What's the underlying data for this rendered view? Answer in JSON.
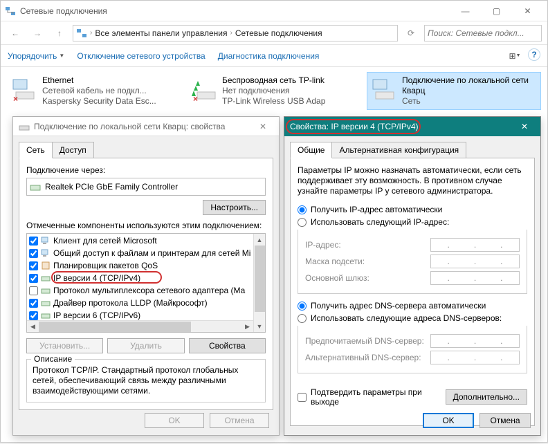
{
  "window": {
    "title": "Сетевые подключения",
    "breadcrumb": {
      "level1": "Все элементы панели управления",
      "level2": "Сетевые подключения"
    },
    "search_placeholder": "Поиск: Сетевые подкл...",
    "btn_min": "—",
    "btn_max": "▢",
    "btn_close": "✕",
    "nav_back": "←",
    "nav_fwd": "→",
    "nav_up": "↑",
    "nav_refresh": "⟳",
    "chevron": "›"
  },
  "toolbar": {
    "organize": "Упорядочить",
    "disable": "Отключение сетевого устройства",
    "diagnose": "Диагностика подключения",
    "view_icon": "⊞",
    "help_icon": "?"
  },
  "connections": [
    {
      "name": "Ethernet",
      "status": "Сетевой кабель не подкл...",
      "adapter": "Kaspersky Security Data Esc...",
      "state": "х"
    },
    {
      "name": "Беспроводная сеть TP-link",
      "status": "Нет подключения",
      "adapter": "TP-Link Wireless USB Adap",
      "state": "х"
    },
    {
      "name": "Подключение по локальной сети Кварц",
      "status": "Сеть",
      "adapter": "",
      "state": "ok"
    }
  ],
  "props": {
    "title": "Подключение по локальной сети Кварц: свойства",
    "tabs": {
      "net": "Сеть",
      "access": "Доступ"
    },
    "connect_via": "Подключение через:",
    "adapter": "Realtek PCIe GbE Family Controller",
    "configure": "Настроить...",
    "checked_label": "Отмеченные компоненты используются этим подключением:",
    "components": [
      {
        "checked": true,
        "label": "Клиент для сетей Microsoft",
        "icon": "pc"
      },
      {
        "checked": true,
        "label": "Общий доступ к файлам и принтерам для сетей Mi",
        "icon": "pc"
      },
      {
        "checked": true,
        "label": "Планировщик пакетов QoS",
        "icon": "srv"
      },
      {
        "checked": true,
        "label": "IP версии 4 (TCP/IPv4)",
        "icon": "net",
        "highlight": true
      },
      {
        "checked": false,
        "label": "Протокол мультиплексора сетевого адаптера (Ма",
        "icon": "net"
      },
      {
        "checked": true,
        "label": "Драйвер протокола LLDP (Майкрософт)",
        "icon": "net"
      },
      {
        "checked": true,
        "label": "IP версии 6 (TCP/IPv6)",
        "icon": "net"
      }
    ],
    "install": "Установить...",
    "remove": "Удалить",
    "properties": "Свойства",
    "desc_title": "Описание",
    "desc": "Протокол TCP/IP. Стандартный протокол глобальных сетей, обеспечивающий связь между различными взаимодействующими сетями.",
    "ok": "OK",
    "cancel": "Отмена"
  },
  "ipv4": {
    "title": "Свойства: IP версии 4 (TCP/IPv4)",
    "tabs": {
      "general": "Общие",
      "alt": "Альтернативная конфигурация"
    },
    "info": "Параметры IP можно назначать автоматически, если сеть поддерживает эту возможность. В противном случае узнайте параметры IP у сетевого администратора.",
    "radio_ip_auto": "Получить IP-адрес автоматически",
    "radio_ip_manual": "Использовать следующий IP-адрес:",
    "ip_label": "IP-адрес:",
    "mask_label": "Маска подсети:",
    "gw_label": "Основной шлюз:",
    "radio_dns_auto": "Получить адрес DNS-сервера автоматически",
    "radio_dns_manual": "Использовать следующие адреса DNS-серверов:",
    "dns1_label": "Предпочитаемый DNS-сервер:",
    "dns2_label": "Альтернативный DNS-сервер:",
    "confirm_exit": "Подтвердить параметры при выходе",
    "advanced": "Дополнительно...",
    "ok": "OK",
    "cancel": "Отмена",
    "close_x": "✕"
  },
  "colors": {
    "teal": "#0e7e7e",
    "red": "#d03030",
    "link": "#1a6db4"
  }
}
